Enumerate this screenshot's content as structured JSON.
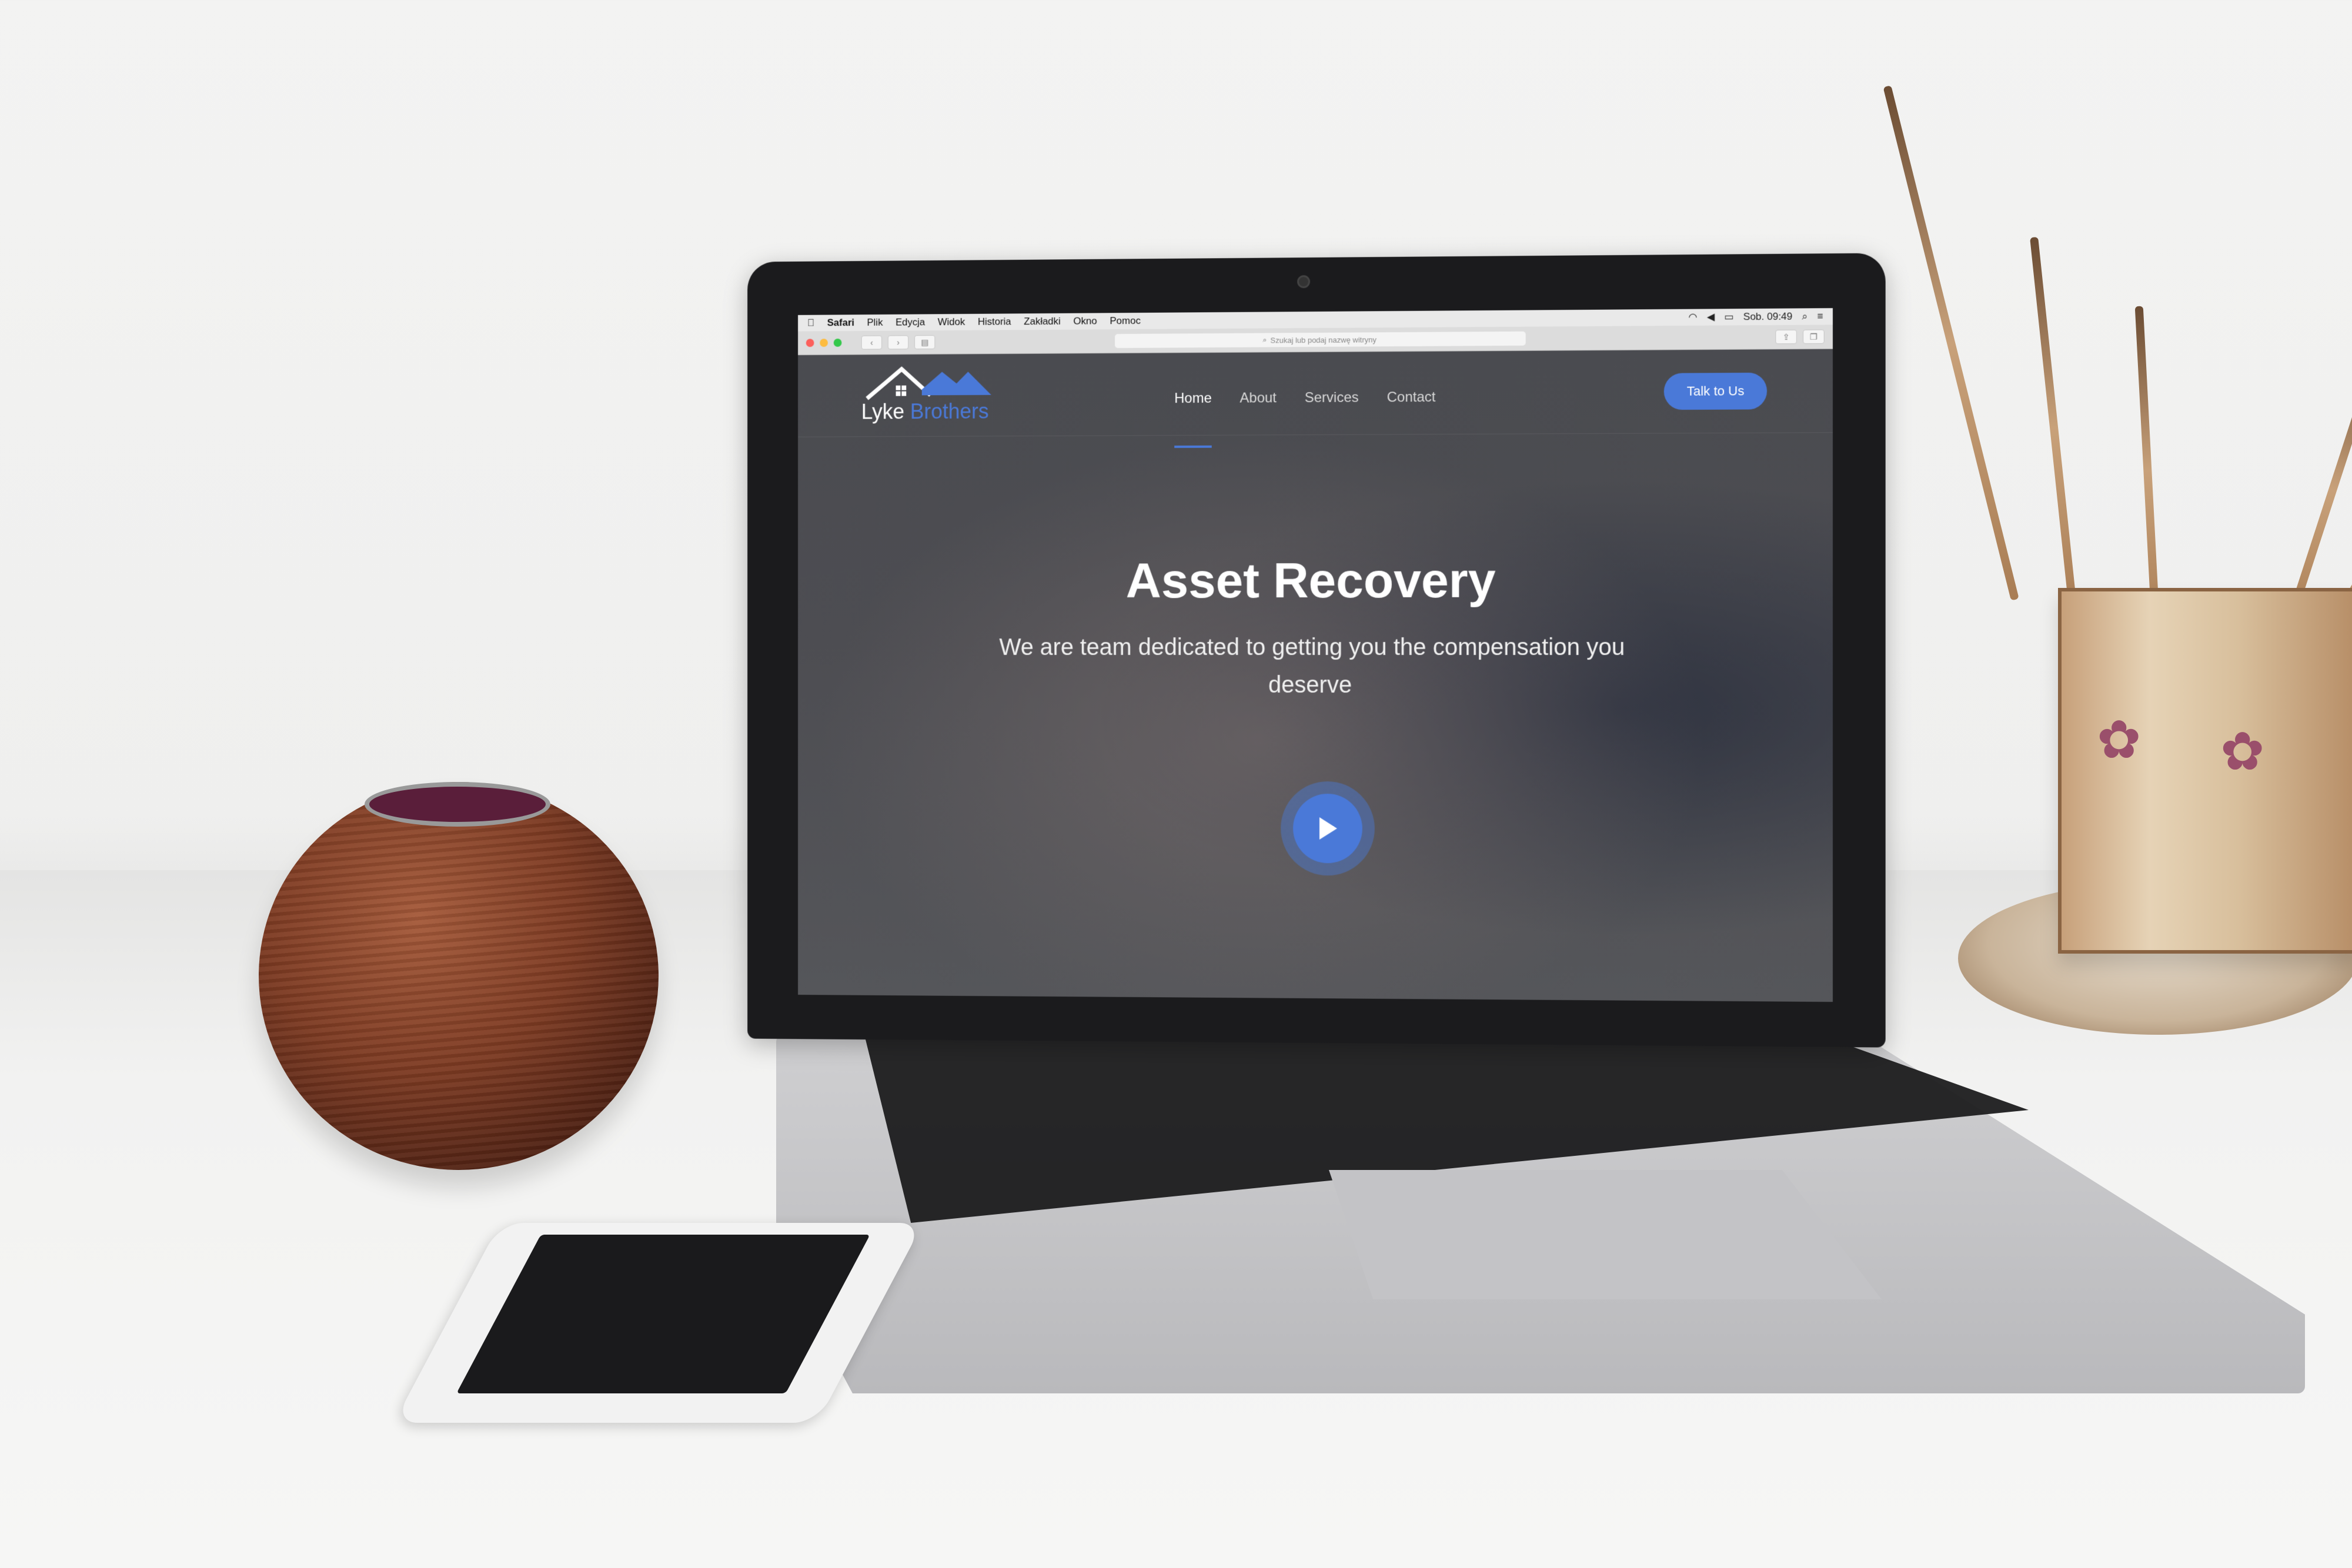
{
  "menubar": {
    "apple": "",
    "items": [
      "Safari",
      "Plik",
      "Edycja",
      "Widok",
      "Historia",
      "Zakładki",
      "Okno",
      "Pomoc"
    ],
    "clock": "Sob. 09:49"
  },
  "browser": {
    "address_placeholder": "Szukaj lub podaj nazwę witryny"
  },
  "site": {
    "logo": {
      "word1": "Lyke",
      "word2": "Brothers"
    },
    "nav": [
      {
        "label": "Home",
        "active": true
      },
      {
        "label": "About",
        "active": false
      },
      {
        "label": "Services",
        "active": false
      },
      {
        "label": "Contact",
        "active": false
      }
    ],
    "cta": "Talk to Us",
    "hero": {
      "title": "Asset Recovery",
      "subtitle": "We are team dedicated to getting you the compensation you deserve"
    },
    "play_icon": "play-icon"
  },
  "colors": {
    "accent": "#4a79d8",
    "hero_bg": "#4a4b50",
    "nav_text": "#d8d8d8"
  }
}
